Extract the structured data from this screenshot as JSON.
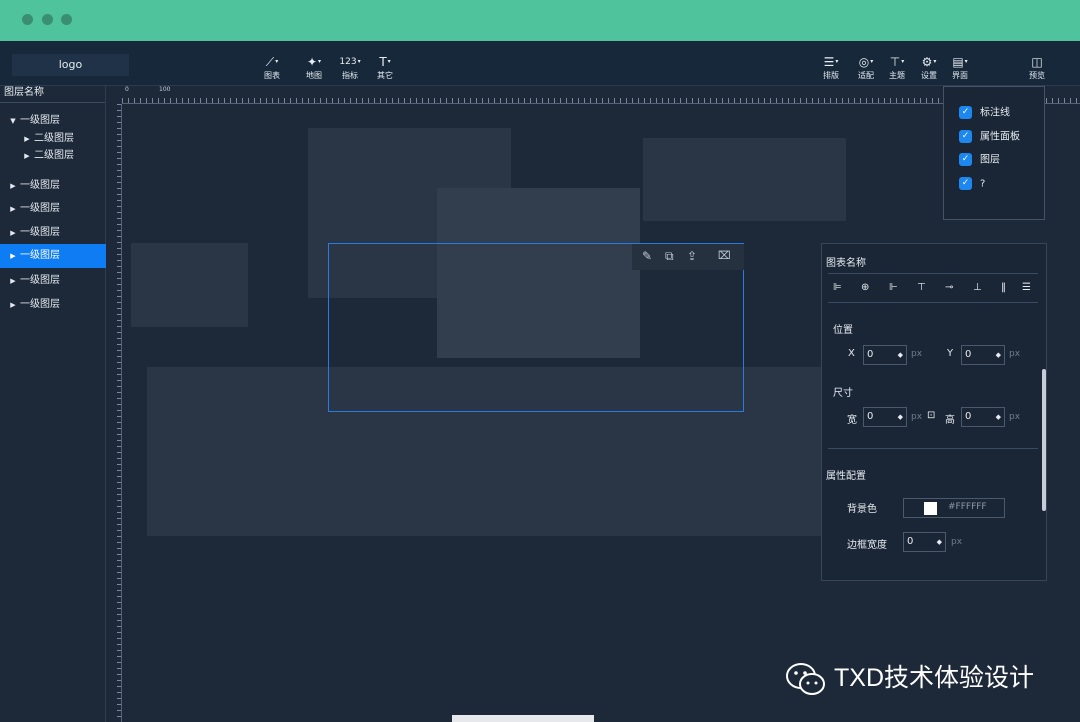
{
  "titlebar": {
    "dots": 3
  },
  "header": {
    "logo": "logo",
    "tools": [
      {
        "icon": "chart-line-icon",
        "glyph": "⟋",
        "label": "图表"
      },
      {
        "icon": "map-icon",
        "glyph": "✦",
        "label": "地图"
      },
      {
        "icon": "number-icon",
        "glyph": "123",
        "label": "指标"
      },
      {
        "icon": "text-icon",
        "glyph": "T",
        "label": "其它"
      }
    ],
    "right_tools": [
      {
        "icon": "layout-list-icon",
        "glyph": "☰",
        "label": "排版"
      },
      {
        "icon": "adapt-icon",
        "glyph": "◎",
        "label": "适配"
      },
      {
        "icon": "shirt-icon",
        "glyph": "⊤",
        "label": "主题"
      },
      {
        "icon": "gear-icon",
        "glyph": "⚙",
        "label": "设置"
      },
      {
        "icon": "interface-icon",
        "glyph": "▤",
        "label": "界面"
      }
    ],
    "preview": {
      "icon": "preview-icon",
      "glyph": "◫",
      "label": "预览"
    }
  },
  "ruler": {
    "label_0": "0",
    "label_100": "100"
  },
  "layers": {
    "title": "图层名称",
    "items": [
      {
        "label": "一级图层",
        "expanded": true,
        "indent": 0
      },
      {
        "label": "二级图层",
        "indent": 1
      },
      {
        "label": "二级图层",
        "indent": 1
      },
      {
        "label": "一级图层",
        "indent": 0
      },
      {
        "label": "一级图层",
        "indent": 0
      },
      {
        "label": "一级图层",
        "indent": 0
      },
      {
        "label": "一级图层",
        "indent": 0,
        "active": true
      },
      {
        "label": "一级图层",
        "indent": 0
      },
      {
        "label": "一级图层",
        "indent": 0
      }
    ]
  },
  "selection_tools": [
    {
      "icon": "edit-icon",
      "glyph": "✎"
    },
    {
      "icon": "copy-icon",
      "glyph": "⧉"
    },
    {
      "icon": "share-icon",
      "glyph": "⇪"
    },
    {
      "icon": "trash-icon",
      "glyph": "🗑"
    }
  ],
  "panel": {
    "title": "图表名称",
    "align_icons": [
      {
        "icon": "align-left-icon",
        "glyph": "⊫"
      },
      {
        "icon": "align-center-h-icon",
        "glyph": "⊕"
      },
      {
        "icon": "align-right-icon",
        "glyph": "⊩"
      },
      {
        "icon": "align-top-icon",
        "glyph": "⊤"
      },
      {
        "icon": "align-middle-v-icon",
        "glyph": "⊸"
      },
      {
        "icon": "align-bottom-icon",
        "glyph": "⊥"
      },
      {
        "icon": "distribute-h-icon",
        "glyph": "‖"
      },
      {
        "icon": "distribute-v-icon",
        "glyph": "☰"
      }
    ],
    "position": {
      "label": "位置",
      "x_label": "X",
      "x_value": "0",
      "y_label": "Y",
      "y_value": "0",
      "unit": "px"
    },
    "size": {
      "label": "尺寸",
      "w_label": "宽",
      "w_value": "0",
      "h_label": "高",
      "h_value": "0",
      "unit": "px"
    },
    "props": {
      "label": "属性配置",
      "bg_label": "背景色",
      "bg_value": "#FFFFFF",
      "border_label": "边框宽度",
      "border_value": "0",
      "unit": "px"
    }
  },
  "interface_menu": {
    "items": [
      {
        "label": "标注线",
        "checked": true
      },
      {
        "label": "属性面板",
        "checked": true
      },
      {
        "label": "图层",
        "checked": true
      },
      {
        "label": "?",
        "checked": true
      }
    ]
  },
  "watermark": {
    "text": "TXD技术体验设计"
  },
  "colors": {
    "accent": "#0e7cf2",
    "titlebar": "#4fc39b",
    "topbar": "#17283a",
    "background": "#1d2838"
  }
}
